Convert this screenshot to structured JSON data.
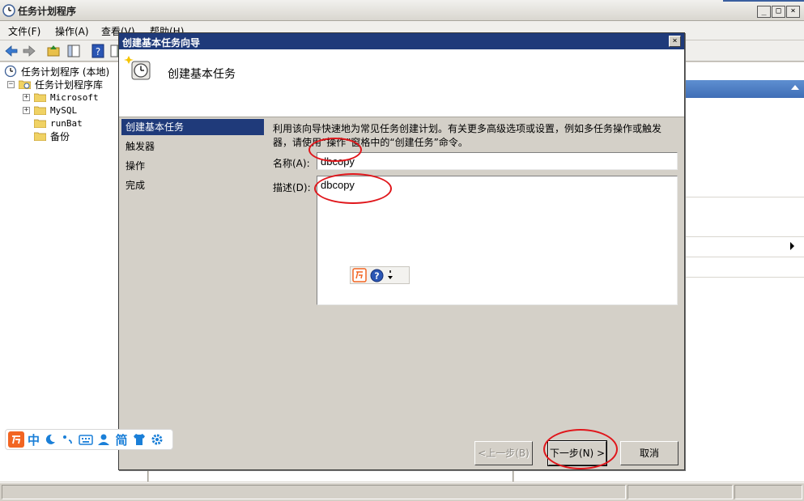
{
  "window": {
    "title": "任务计划程序",
    "controls": {
      "minimize": "_",
      "maximize": "□",
      "close": "×"
    }
  },
  "menu": [
    {
      "label": "文件(F)"
    },
    {
      "label": "操作(A)"
    },
    {
      "label": "查看(V)"
    },
    {
      "label": "帮助(H)"
    }
  ],
  "tree": {
    "root": "任务计划程序 (本地)",
    "library": "任务计划程序库",
    "items": [
      "Microsoft",
      "MySQL",
      "runBat",
      "备份"
    ],
    "expanders": {
      "collapse": "−",
      "expand": "+"
    }
  },
  "dialog": {
    "title": "创建基本任务向导",
    "close": "×",
    "header": "创建基本任务",
    "nav": [
      "创建基本任务",
      "触发器",
      "操作",
      "完成"
    ],
    "description_line1": "利用该向导快速地为常见任务创建计划。有关更多高级选项或设置，例如多任务操作或触发",
    "description_line2": "器，请使用“操作”窗格中的“创建任务”命令。",
    "name_label": "名称(A):",
    "name_value": "dbcopy",
    "desc_label": "描述(D):",
    "desc_value": "dbcopy",
    "buttons": {
      "back": "<上一步(B)",
      "next": "下一步(N) >",
      "cancel": "取消"
    }
  },
  "ime": {
    "mode": "中"
  },
  "colors": {
    "accent": "#1f3a7a",
    "annotation": "#e0161b",
    "ime_orange": "#f26522",
    "ime_blue": "#1a7fd8"
  }
}
